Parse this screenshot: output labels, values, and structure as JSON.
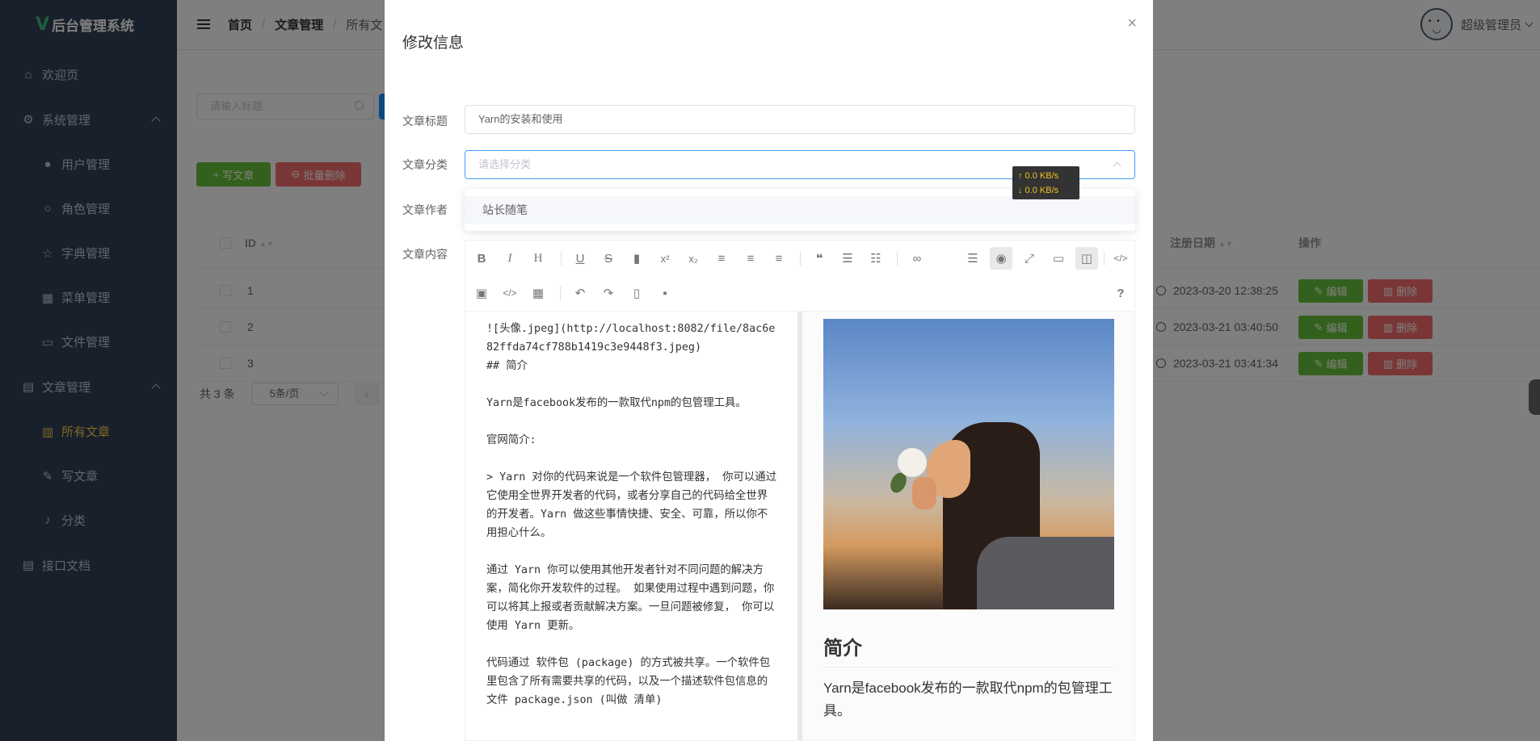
{
  "app": {
    "title": "后台管理系统"
  },
  "sidebar": {
    "items": [
      {
        "label": "欢迎页",
        "icon": "home-icon"
      },
      {
        "label": "系统管理",
        "icon": "gear-icon"
      },
      {
        "label": "用户管理",
        "icon": "user-icon"
      },
      {
        "label": "角色管理",
        "icon": "user-outline-icon"
      },
      {
        "label": "字典管理",
        "icon": "star-icon"
      },
      {
        "label": "菜单管理",
        "icon": "grid-icon"
      },
      {
        "label": "文件管理",
        "icon": "folder-icon"
      },
      {
        "label": "文章管理",
        "icon": "document-icon"
      },
      {
        "label": "所有文章",
        "icon": "notebook-icon"
      },
      {
        "label": "写文章",
        "icon": "edit-icon"
      },
      {
        "label": "分类",
        "icon": "bell-icon"
      },
      {
        "label": "接口文档",
        "icon": "tickets-icon"
      }
    ]
  },
  "header": {
    "breadcrumb": [
      "首页",
      "文章管理",
      "所有文"
    ],
    "username": "超级管理员"
  },
  "main": {
    "search_placeholder": "请输入标题",
    "write_label": "写文章",
    "batch_delete_label": "批量删除",
    "table": {
      "columns": {
        "id": "ID",
        "date": "注册日期",
        "actions": "操作"
      },
      "rows": [
        {
          "id": "1",
          "date": "2023-03-20 12:38:25"
        },
        {
          "id": "2",
          "date": "2023-03-21 03:40:50"
        },
        {
          "id": "3",
          "date": "2023-03-21 03:41:34"
        }
      ],
      "edit_label": "编辑",
      "delete_label": "删除"
    },
    "pagination": {
      "total": "共 3 条",
      "page_size": "5条/页",
      "prev": "‹"
    }
  },
  "dialog": {
    "title": "修改信息",
    "close": "×",
    "fields": {
      "title_label": "文章标题",
      "title_value": "Yarn的安装和使用",
      "category_label": "文章分类",
      "category_placeholder": "请选择分类",
      "author_label": "文章作者",
      "content_label": "文章内容"
    },
    "dropdown_options": [
      "站长随笔"
    ],
    "net_speed": {
      "up": "↑ 0.0 KB/s",
      "down": "↓ 0.0 KB/s"
    },
    "editor": {
      "source_lines": [
        "![头像.jpeg](http://localhost:8082/file/8ac6e82ffda74cf788b1419c3e9448f3.jpeg)",
        "## 简介",
        "",
        "Yarn是facebook发布的一款取代npm的包管理工具。",
        "",
        "官网简介:",
        "",
        "> Yarn 对你的代码来说是一个软件包管理器， 你可以通过它使用全世界开发者的代码，或者分享自己的代码给全世界的开发者。Yarn 做这些事情快捷、安全、可靠，所以你不用担心什么。",
        "",
        "通过 Yarn 你可以使用其他开发者针对不同问题的解决方案，简化你开发软件的过程。 如果使用过程中遇到问题，你可以将其上报或者贡献解决方案。一旦问题被修复， 你可以使用 Yarn 更新。",
        "",
        "代码通过 软件包 (package) 的方式被共享。一个软件包里包含了所有需要共享的代码，以及一个描述软件包信息的文件 package.json (叫做 清单)"
      ],
      "preview_heading": "简介",
      "preview_text": "Yarn是facebook发布的一款取代npm的包管理工具。"
    }
  }
}
